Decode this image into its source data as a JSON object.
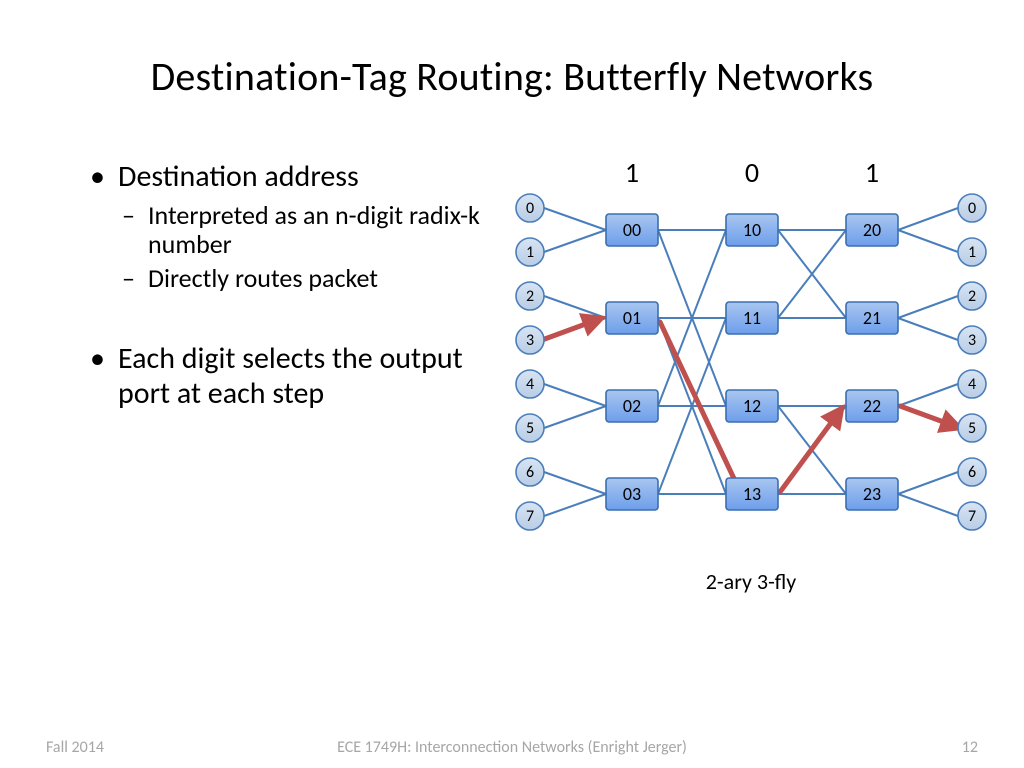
{
  "title": "Destination-Tag Routing: Butterfly Networks",
  "bullets": {
    "b1a": "Destination address",
    "b1a_sub1": "Interpreted as an n-digit radix-k number",
    "b1a_sub2": "Directly routes packet",
    "b1b": "Each digit selects the output port at each step"
  },
  "diagram": {
    "digits": [
      "1",
      "0",
      "1"
    ],
    "left_ports": [
      "0",
      "1",
      "2",
      "3",
      "4",
      "5",
      "6",
      "7"
    ],
    "right_ports": [
      "0",
      "1",
      "2",
      "3",
      "4",
      "5",
      "6",
      "7"
    ],
    "switches": {
      "col0": [
        "00",
        "01",
        "02",
        "03"
      ],
      "col1": [
        "10",
        "11",
        "12",
        "13"
      ],
      "col2": [
        "20",
        "21",
        "22",
        "23"
      ]
    },
    "caption": "2-ary 3-fly",
    "route": {
      "src_port": 3,
      "sw_path": [
        "01",
        "13",
        "22"
      ],
      "dst_port": 5
    }
  },
  "footer": {
    "left": "Fall 2014",
    "center": "ECE 1749H: Interconnection Networks (Enright Jerger)",
    "right": "12"
  },
  "colors": {
    "node_fill_lite": "#b9cde5",
    "node_fill_dark": "#5b8cc8",
    "node_stroke": "#4a7ebb",
    "sw_fill": "#6d9eeb",
    "sw_stroke": "#3a6fb0",
    "link": "#4a7ebb",
    "route": "#c0504d"
  }
}
